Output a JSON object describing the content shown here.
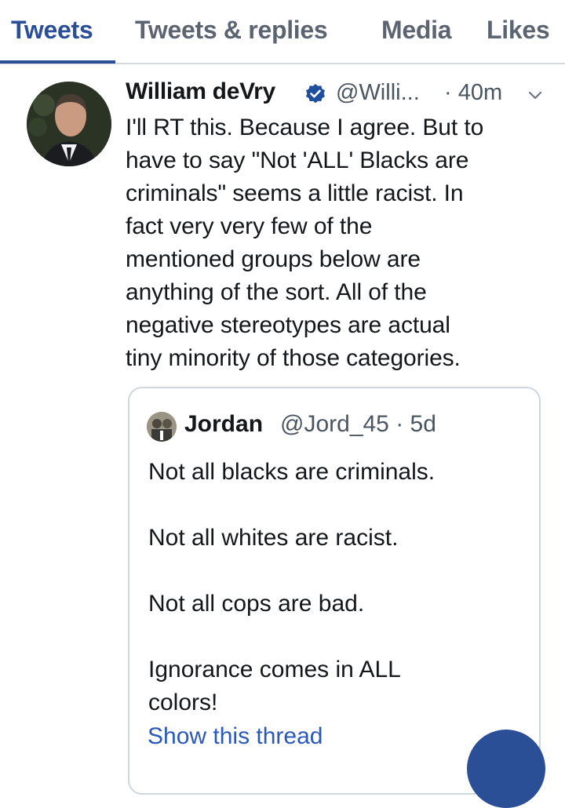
{
  "tabs": [
    {
      "label": "Tweets",
      "active": true
    },
    {
      "label": "Tweets & replies",
      "active": false
    },
    {
      "label": "Media",
      "active": false
    },
    {
      "label": "Likes",
      "active": false
    }
  ],
  "tweet": {
    "author_name": "William deVry",
    "handle": "@Willi...",
    "time": "· 40m",
    "verified": true,
    "text": "I'll RT this. Because I agree. But to\nhave to say \"Not 'ALL' Blacks are\ncriminals\" seems a little racist. In\nfact very very few of the\nmentioned groups below are\nanything of the sort. All of the\nnegative stereotypes are actual\ntiny minority of those categories."
  },
  "quote": {
    "author_name": "Jordan",
    "handle_time": "@Jord_45 · 5d",
    "text": "Not all blacks are criminals.\n\nNot all whites are racist.\n\nNot all cops are bad.\n\nIgnorance comes in ALL\ncolors!",
    "show_thread": "Show this thread"
  },
  "colors": {
    "accent": "#2b4f96",
    "link": "#2b59b8",
    "verified": "#1d4f9e"
  }
}
